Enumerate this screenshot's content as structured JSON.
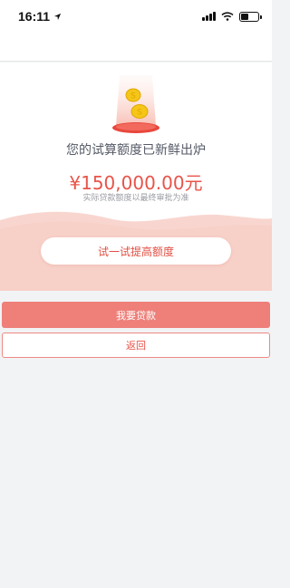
{
  "status_bar": {
    "time": "16:11",
    "icons": [
      "location-arrow-icon",
      "signal-icon",
      "wifi-icon",
      "battery-icon"
    ]
  },
  "result": {
    "title": "您的试算额度已新鲜出炉",
    "amount": "¥150,000.00元",
    "note": "实际贷款额度以最终审批为准",
    "raise_label": "试一试提高额度"
  },
  "actions": {
    "loan_label": "我要贷款",
    "back_label": "返回"
  },
  "colors": {
    "accent": "#e8544a",
    "primary_button": "#ee7f79",
    "pink_band": "#f8d6cf",
    "coin": "#f5c518"
  }
}
